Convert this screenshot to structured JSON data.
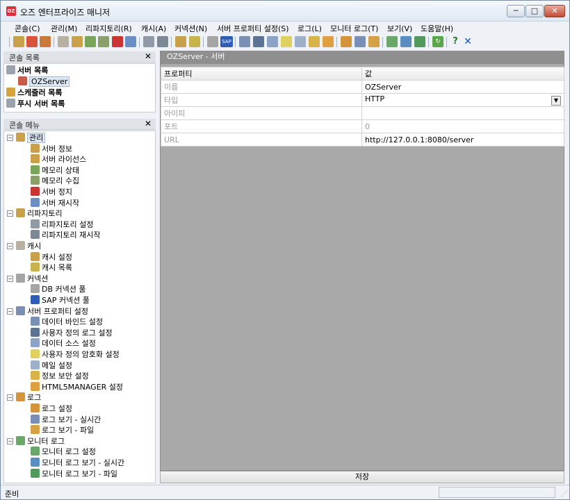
{
  "window": {
    "title": "오즈 엔터프라이즈 매니저",
    "app_icon_text": "OZ",
    "min_glyph": "─",
    "max_glyph": "□",
    "close_glyph": "✕"
  },
  "menu": [
    "콘솔(C)",
    "관리(M)",
    "리파지토리(R)",
    "캐시(A)",
    "커넥션(N)",
    "서버 프로퍼티 설정(S)",
    "로그(L)",
    "모니터 로그(T)",
    "보기(V)",
    "도움말(H)"
  ],
  "toolbar_icons": [
    "server-icon",
    "license-icon",
    "memory-icon",
    "gc-icon",
    "stop-icon",
    "restart-icon",
    "repository-config-icon",
    "repository-restart-icon",
    "cache-config-icon",
    "cache-list-icon",
    "db-pool-icon",
    "sap-pool-icon",
    "data-bind-icon",
    "user-log-icon",
    "datasource-icon",
    "encryption-icon",
    "mail-icon",
    "lock-icon",
    "html5-icon",
    "log-config-icon",
    "log-realtime-icon",
    "log-file-icon",
    "monitor-config-icon",
    "monitor-realtime-icon",
    "monitor-file-icon",
    "refresh-icon",
    "help-icon",
    "close-icon"
  ],
  "console_list": {
    "title": "콘솔 목록",
    "close": "✕",
    "items": [
      {
        "label": "서버 목록",
        "bold": true
      },
      {
        "label": "OZServer",
        "bold": false
      },
      {
        "label": "스케줄러 목록",
        "bold": true
      },
      {
        "label": "푸시 서버 목록",
        "bold": true
      }
    ]
  },
  "console_menu": {
    "title": "콘솔 메뉴",
    "close": "✕",
    "groups": [
      {
        "label": "관리",
        "items": [
          "서버 정보",
          "서버 라이선스",
          "메모리 상태",
          "메모리 수집",
          "서버 정지",
          "서버 재시작"
        ]
      },
      {
        "label": "리파지토리",
        "items": [
          "리파지토리 설정",
          "리파지토리 재시작"
        ]
      },
      {
        "label": "캐시",
        "items": [
          "캐시 설정",
          "캐시 목록"
        ]
      },
      {
        "label": "커넥션",
        "items": [
          "DB 커넥션 풀",
          "SAP 커넥션 풀"
        ]
      },
      {
        "label": "서버 프로퍼티 설정",
        "items": [
          "데이터 바인드 설정",
          "사용자 정의 로그 설정",
          "데이터 소스 설정",
          "사용자 정의 암호화 설정",
          "메일 설정",
          "정보 보안 설정",
          "HTML5MANAGER 설정"
        ]
      },
      {
        "label": "로그",
        "items": [
          "로그 설정",
          "로그 보기 - 실시간",
          "로그 보기 - 파일"
        ]
      },
      {
        "label": "모니터 로그",
        "items": [
          "모니터 로그 설정",
          "모니터 로그 보기 - 실시간",
          "모니터 로그 보기 - 파일"
        ]
      }
    ]
  },
  "property_panel": {
    "title": "OZServer - 서버",
    "columns": [
      "프로퍼티",
      "값"
    ],
    "rows": [
      {
        "name": "이름",
        "value": "OZServer"
      },
      {
        "name": "타입",
        "value": "HTTP"
      },
      {
        "name": "아이피",
        "value": ""
      },
      {
        "name": "포트",
        "value": "0"
      },
      {
        "name": "URL",
        "value": "http://127.0.0.1:8080/server"
      }
    ],
    "dropdown_glyph": "▼"
  },
  "save_label": "저장",
  "status": {
    "text": "준비"
  }
}
